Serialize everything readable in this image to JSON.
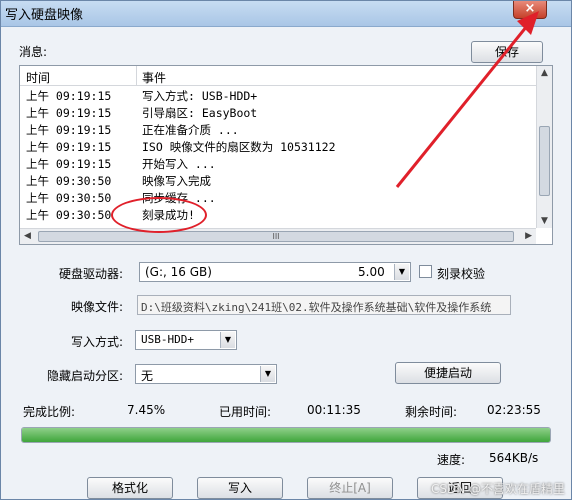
{
  "window": {
    "title": "写入硬盘映像",
    "close_label": "×"
  },
  "messages": {
    "label": "消息:",
    "save_button": "保存",
    "columns": [
      "时间",
      "事件"
    ],
    "rows": [
      {
        "time": "上午 09:19:15",
        "event": "写入方式: USB-HDD+"
      },
      {
        "time": "上午 09:19:15",
        "event": "引导扇区: EasyBoot"
      },
      {
        "time": "上午 09:19:15",
        "event": "正在准备介质 ..."
      },
      {
        "time": "上午 09:19:15",
        "event": "ISO 映像文件的扇区数为 10531122"
      },
      {
        "time": "上午 09:19:15",
        "event": "开始写入 ..."
      },
      {
        "time": "上午 09:30:50",
        "event": "映像写入完成"
      },
      {
        "time": "上午 09:30:50",
        "event": "同步缓存 ..."
      },
      {
        "time": "上午 09:30:50",
        "event": "刻录成功!"
      }
    ],
    "hscroll_grip": "III"
  },
  "drive": {
    "label": "硬盘驱动器:",
    "value": "(G:, 16 GB)",
    "size": "5.00",
    "verify_label": "刻录校验"
  },
  "image_file": {
    "label": "映像文件:",
    "value": "D:\\班级资料\\zking\\241班\\02.软件及操作系统基础\\软件及操作系统"
  },
  "write_mode": {
    "label": "写入方式:",
    "value": "USB-HDD+"
  },
  "hidden_partition": {
    "label": "隐藏启动分区:",
    "value": "无"
  },
  "quick_boot_button": "便捷启动",
  "stats": {
    "ratio_label": "完成比例:",
    "ratio_value": "7.45%",
    "used_label": "已用时间:",
    "used_value": "00:11:35",
    "remain_label": "剩余时间:",
    "remain_value": "02:23:55",
    "speed_label": "速度:",
    "speed_value": "564KB/s"
  },
  "progress": {
    "fraction": 1.0
  },
  "buttons": {
    "format": "格式化",
    "write": "写入",
    "abort": "终止[A]",
    "back": "返回"
  },
  "watermark": "CSDN @不喜欢在盾精里",
  "colors": {
    "title_bar": "#a9c6e6",
    "close": "#c5412a",
    "progress": "#3fa53b",
    "annotation": "#e0202a"
  }
}
